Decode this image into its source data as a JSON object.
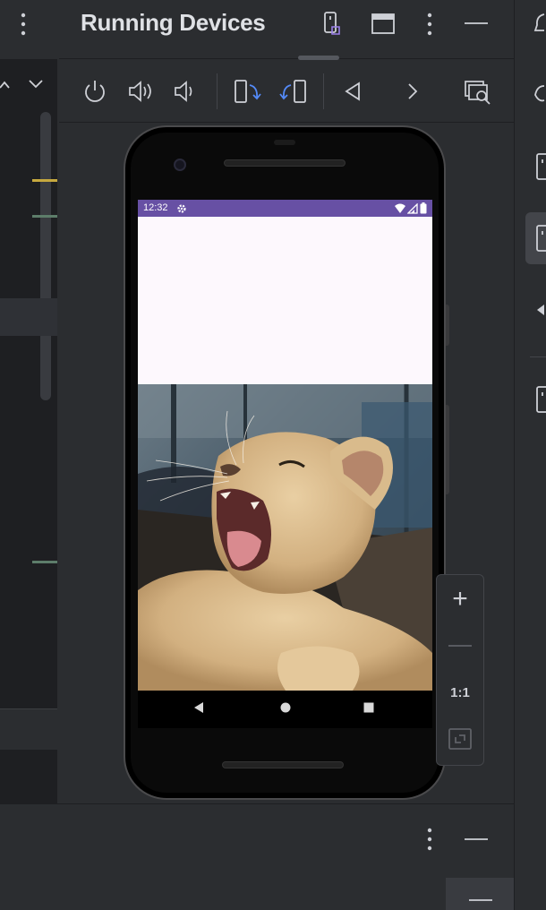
{
  "panel": {
    "title": "Running Devices"
  },
  "title_bar_actions": [
    {
      "name": "device-selector-icon"
    },
    {
      "name": "window-layout-icon"
    },
    {
      "name": "more-options-icon"
    },
    {
      "name": "minimize-icon"
    }
  ],
  "toolbar": {
    "buttons": [
      {
        "name": "power-icon"
      },
      {
        "name": "volume-up-icon"
      },
      {
        "name": "volume-down-icon"
      },
      {
        "name": "rotate-left-icon"
      },
      {
        "name": "rotate-right-icon"
      },
      {
        "name": "back-icon"
      },
      {
        "name": "forward-icon"
      },
      {
        "name": "screenshot-search-icon"
      }
    ]
  },
  "device": {
    "status_bar": {
      "time": "12:32",
      "color": "#6750a4"
    },
    "app_background": "#fdf8fd",
    "photo": "lion-cub-yawning"
  },
  "zoom": {
    "zoom_in": "+",
    "zoom_out": "—",
    "actual_size": "1:1",
    "fit": "fit-screen-icon"
  },
  "bottom_panel": {
    "actions": [
      {
        "name": "more-options-icon"
      },
      {
        "name": "minimize-icon"
      }
    ]
  },
  "colors": {
    "accent": "#6750a4",
    "ide_background": "#2b2d30",
    "editor_background": "#1e1f22",
    "active_blue": "#548af7"
  }
}
